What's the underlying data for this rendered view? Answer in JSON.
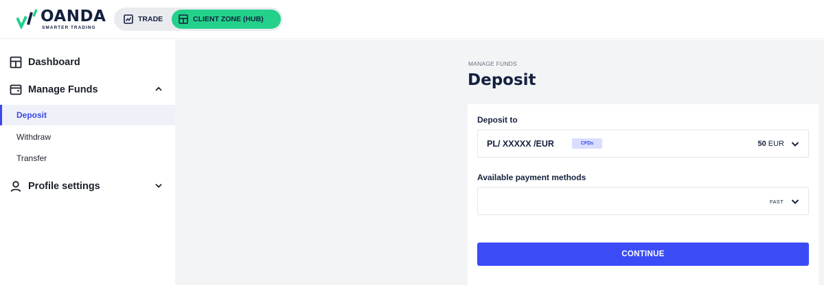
{
  "brand": {
    "name": "OANDA",
    "tagline": "SMARTER TRADING",
    "accent": "#23d18b",
    "navy": "#14213d"
  },
  "switcher": {
    "trade_label": "TRADE",
    "hub_label": "CLIENT ZONE (HUB)"
  },
  "sidebar": {
    "dashboard": "Dashboard",
    "manage_funds": "Manage Funds",
    "deposit": "Deposit",
    "withdraw": "Withdraw",
    "transfer": "Transfer",
    "profile_settings": "Profile settings"
  },
  "main": {
    "breadcrumb": "MANAGE FUNDS",
    "title": "Deposit",
    "deposit_to_label": "Deposit to",
    "account": {
      "name": "PL/ XXXXX /EUR",
      "tag": "CFDs",
      "amount": "50",
      "currency": "EUR"
    },
    "payment_label": "Available payment methods",
    "payment_method": {
      "value": "",
      "speed": "FAST"
    },
    "continue_label": "CONTINUE"
  },
  "colors": {
    "primary": "#3b4cf7",
    "active_nav": "#3b47e8",
    "content_bg": "#f3f4f6"
  }
}
